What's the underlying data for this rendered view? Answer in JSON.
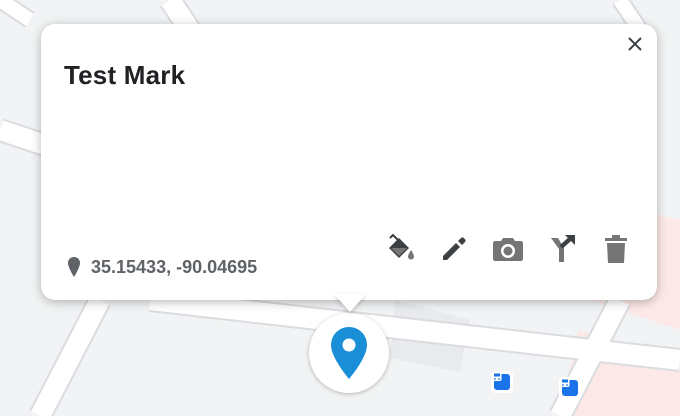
{
  "marker": {
    "title": "Test Mark",
    "coordinates": "35.15433, -90.04695"
  },
  "icons": {
    "close": "close-icon",
    "fill": "paint-bucket-icon",
    "edit": "pencil-icon",
    "photo": "camera-icon",
    "directions": "directions-icon",
    "delete": "trash-icon",
    "location": "location-pin-icon",
    "map_pin": "map-pin-icon",
    "transit": "bus-icon"
  },
  "colors": {
    "accent": "#1a73e8",
    "pin": "#1a8fd8",
    "icon_gray": "#5f6368",
    "icon_dark": "#3c4043"
  }
}
